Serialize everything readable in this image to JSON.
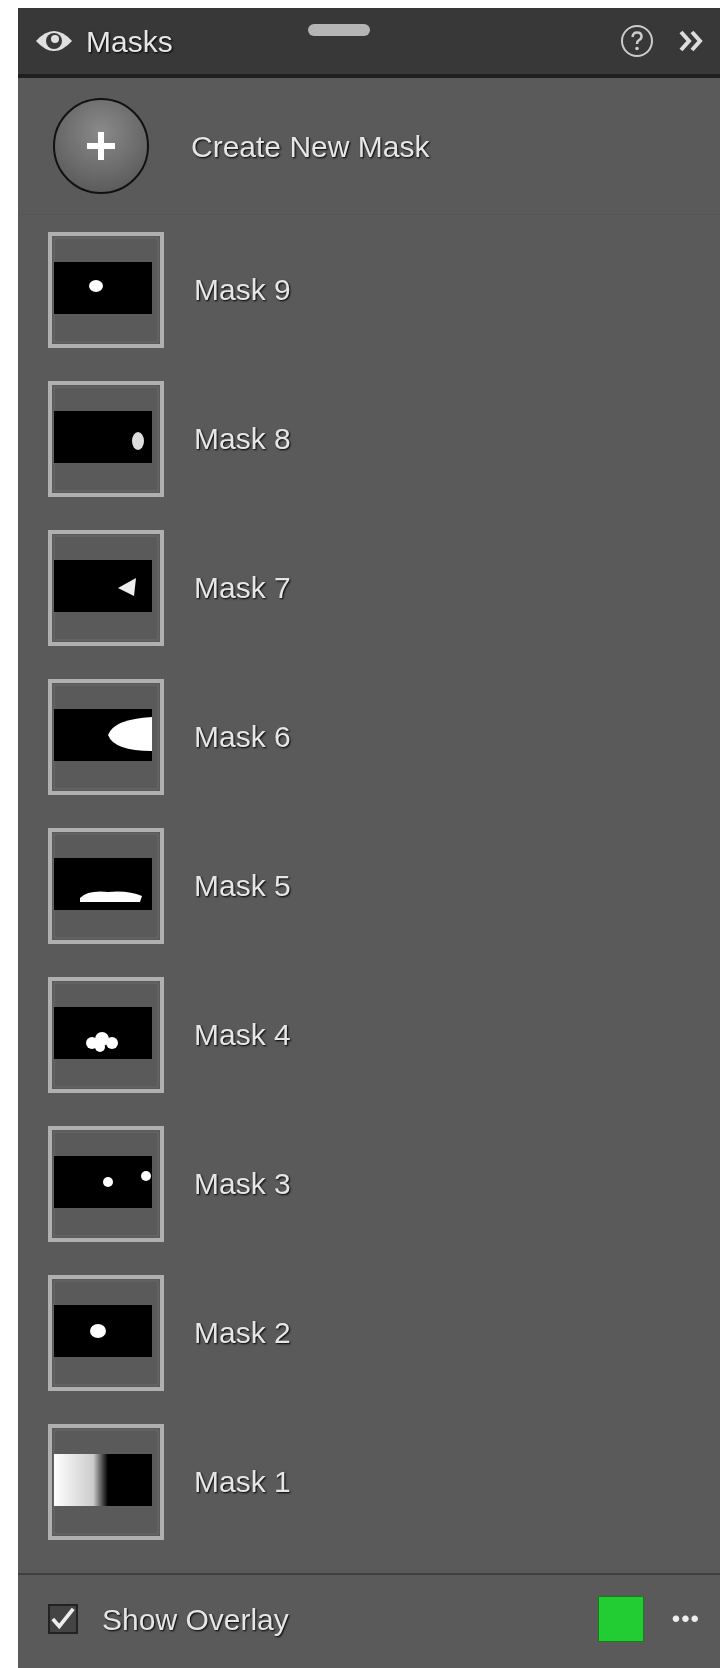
{
  "panel": {
    "title": "Masks"
  },
  "create_button": {
    "label": "Create New Mask"
  },
  "masks": [
    {
      "label": "Mask 9",
      "kind": "picture"
    },
    {
      "label": "Mask 8",
      "kind": "picture"
    },
    {
      "label": "Mask 7",
      "kind": "picture"
    },
    {
      "label": "Mask 6",
      "kind": "picture"
    },
    {
      "label": "Mask 5",
      "kind": "picture"
    },
    {
      "label": "Mask 4",
      "kind": "picture"
    },
    {
      "label": "Mask 3",
      "kind": "picture"
    },
    {
      "label": "Mask 2",
      "kind": "picture"
    },
    {
      "label": "Mask 1",
      "kind": "picture"
    }
  ],
  "footer": {
    "label": "Show Overlay",
    "checked": true,
    "color": "#22cc33",
    "more": "•••"
  }
}
